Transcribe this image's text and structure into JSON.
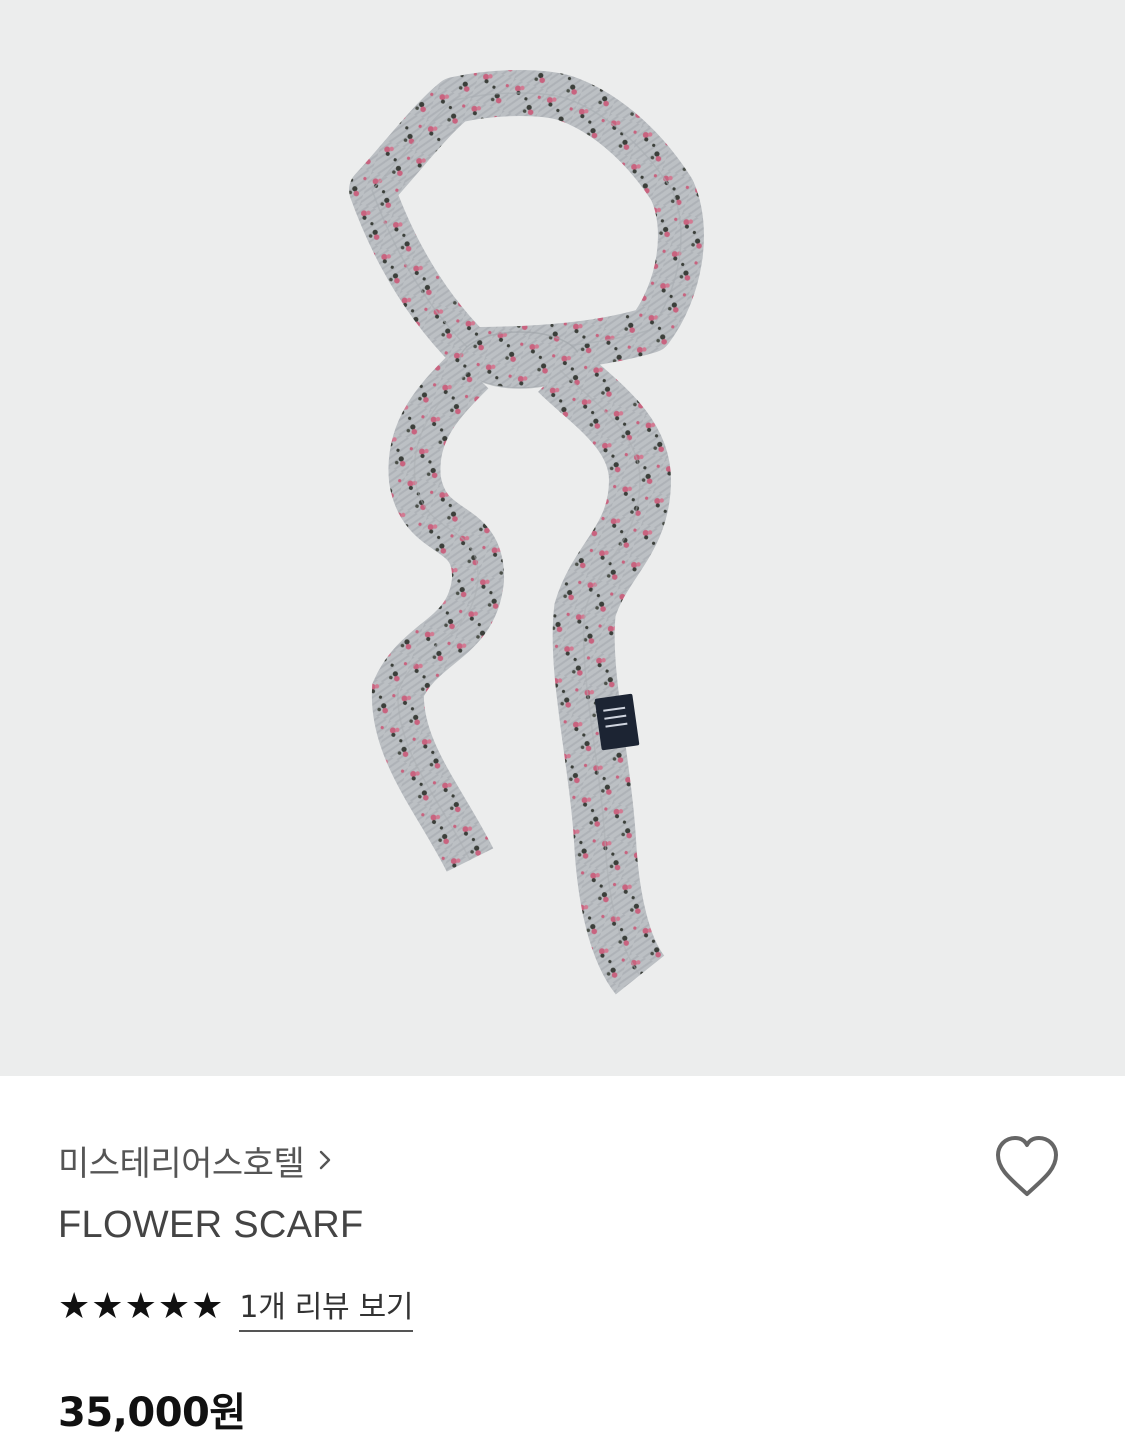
{
  "product": {
    "image_alt": "flower-scarf-product-image",
    "brand": "미스테리어스호텔",
    "brand_chevron": "chevron-right-icon",
    "name": "FLOWER SCARF",
    "rating": {
      "stars": 5,
      "max": 5,
      "star_icon": "star-icon"
    },
    "review_link": "1개 리뷰 보기",
    "price": "35,000원",
    "wishlist_icon": "heart-outline-icon"
  },
  "colors": {
    "hero_background": "#eceded",
    "scarf_base": "#b9bcc0",
    "flower_pink": "#c8637f",
    "flower_dark": "#3b3f3a"
  }
}
